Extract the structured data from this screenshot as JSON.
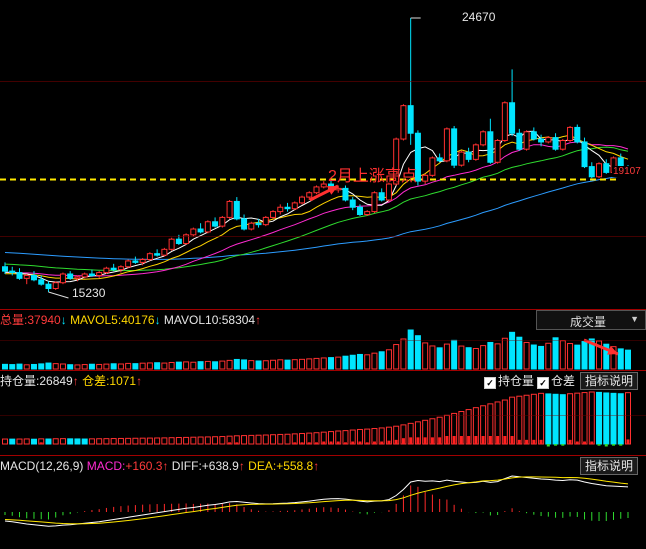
{
  "colors": {
    "up": "#ff3030",
    "down": "#00e5ff",
    "ma5": "#ffffff",
    "ma10": "#ffd400",
    "ma20": "#ff2bd1",
    "ma30": "#2fdc2f",
    "ma60": "#2c9cff",
    "dashed_line": "#ffea00",
    "macd_diff": "#ffffff",
    "macd_dea": "#ffe600"
  },
  "price_panel": {
    "high_label": "24670",
    "low_label": "15230",
    "last_price_label": "19107",
    "annotation": "2月上涨高点"
  },
  "volume_panel": {
    "total_label": "总量:",
    "total_value": "37940",
    "total_arrow": "↓",
    "mavol5_label": "MAVOL5:",
    "mavol5_value": "40176",
    "mavol5_arrow": "↓",
    "mavol10_label": "MAVOL10:",
    "mavol10_value": "58304",
    "mavol10_arrow": "↑",
    "dropdown_value": "成交量",
    "dropdown_icon": "triangle-down-icon"
  },
  "oi_panel": {
    "oi_label": "持仓量:",
    "oi_value": "26849",
    "oi_arrow": "↑",
    "diff_label": "仓差:",
    "diff_value": "1071",
    "diff_arrow": "↑",
    "check_oi": "持仓量",
    "check_diff": "仓差",
    "indicator_button": "指标说明"
  },
  "macd_panel": {
    "name_label": "MACD(12,26,9)",
    "macd_label": "MACD:",
    "macd_value": "+160.3",
    "macd_arrow": "↑",
    "diff_label": "DIFF:",
    "diff_value": "+638.9",
    "diff_arrow": "↑",
    "dea_label": "DEA:",
    "dea_value": "+558.8",
    "dea_arrow": "↑",
    "indicator_button": "指标说明"
  },
  "chart_data": {
    "type": "candlestick",
    "dashed_level": 19107,
    "ohlc": [
      [
        16100,
        16250,
        15850,
        15950
      ],
      [
        15950,
        16100,
        15800,
        15900
      ],
      [
        15900,
        16050,
        15650,
        15700
      ],
      [
        15700,
        15850,
        15500,
        15800
      ],
      [
        15800,
        15950,
        15600,
        15650
      ],
      [
        15650,
        15800,
        15450,
        15500
      ],
      [
        15500,
        15600,
        15230,
        15350
      ],
      [
        15350,
        15600,
        15300,
        15550
      ],
      [
        15550,
        15900,
        15500,
        15850
      ],
      [
        15850,
        15950,
        15650,
        15700
      ],
      [
        15700,
        15800,
        15600,
        15750
      ],
      [
        15750,
        15900,
        15700,
        15850
      ],
      [
        15850,
        16000,
        15750,
        15800
      ],
      [
        15800,
        15950,
        15700,
        15900
      ],
      [
        15900,
        16100,
        15850,
        16050
      ],
      [
        16050,
        16200,
        15950,
        16000
      ],
      [
        16000,
        16150,
        15900,
        16100
      ],
      [
        16100,
        16350,
        16050,
        16300
      ],
      [
        16300,
        16450,
        16200,
        16250
      ],
      [
        16250,
        16400,
        16150,
        16350
      ],
      [
        16350,
        16600,
        16300,
        16550
      ],
      [
        16550,
        16700,
        16450,
        16500
      ],
      [
        16500,
        16750,
        16450,
        16700
      ],
      [
        16700,
        17100,
        16650,
        17050
      ],
      [
        17050,
        17200,
        16850,
        16900
      ],
      [
        16900,
        17250,
        16850,
        17200
      ],
      [
        17200,
        17450,
        17150,
        17400
      ],
      [
        17400,
        17600,
        17250,
        17300
      ],
      [
        17300,
        17700,
        17250,
        17650
      ],
      [
        17650,
        17800,
        17450,
        17500
      ],
      [
        17500,
        17850,
        17450,
        17800
      ],
      [
        17800,
        18400,
        17750,
        18350
      ],
      [
        18350,
        18500,
        17700,
        17750
      ],
      [
        17750,
        17900,
        17350,
        17400
      ],
      [
        17400,
        17650,
        17350,
        17600
      ],
      [
        17600,
        17750,
        17450,
        17550
      ],
      [
        17550,
        17850,
        17500,
        17800
      ],
      [
        17800,
        18050,
        17750,
        18000
      ],
      [
        18000,
        18250,
        17900,
        18150
      ],
      [
        18150,
        18300,
        18000,
        18100
      ],
      [
        18100,
        18350,
        18050,
        18300
      ],
      [
        18300,
        18550,
        18250,
        18500
      ],
      [
        18500,
        18700,
        18400,
        18650
      ],
      [
        18650,
        18900,
        18600,
        18850
      ],
      [
        18850,
        19050,
        18800,
        18950
      ],
      [
        18950,
        19100,
        18700,
        18750
      ],
      [
        18750,
        18900,
        18650,
        18800
      ],
      [
        18800,
        18900,
        18350,
        18400
      ],
      [
        18400,
        18500,
        18050,
        18150
      ],
      [
        18150,
        18250,
        17850,
        17900
      ],
      [
        17900,
        18050,
        17850,
        18000
      ],
      [
        18000,
        18700,
        17950,
        18650
      ],
      [
        18650,
        18800,
        18350,
        18400
      ],
      [
        18400,
        19000,
        18350,
        18950
      ],
      [
        18950,
        20550,
        18900,
        20500
      ],
      [
        20500,
        21700,
        20450,
        21650
      ],
      [
        21650,
        24670,
        20300,
        20700
      ],
      [
        20700,
        20800,
        18900,
        19050
      ],
      [
        19050,
        19300,
        18950,
        19250
      ],
      [
        19250,
        19900,
        19200,
        19850
      ],
      [
        19850,
        20000,
        19700,
        19750
      ],
      [
        19750,
        20900,
        19700,
        20850
      ],
      [
        20850,
        20950,
        19500,
        19600
      ],
      [
        19600,
        20100,
        19550,
        20050
      ],
      [
        20050,
        20200,
        19700,
        19800
      ],
      [
        19800,
        20350,
        19750,
        20300
      ],
      [
        20300,
        20800,
        20250,
        20750
      ],
      [
        20750,
        21200,
        19650,
        19700
      ],
      [
        19700,
        20500,
        19650,
        20450
      ],
      [
        20450,
        21800,
        20400,
        21750
      ],
      [
        21750,
        22900,
        20600,
        20700
      ],
      [
        20700,
        20850,
        20100,
        20150
      ],
      [
        20150,
        20800,
        20100,
        20750
      ],
      [
        20750,
        20900,
        20450,
        20500
      ],
      [
        20500,
        20650,
        20250,
        20400
      ],
      [
        20400,
        20600,
        20350,
        20550
      ],
      [
        20550,
        20700,
        20100,
        20150
      ],
      [
        20150,
        20500,
        20100,
        20450
      ],
      [
        20450,
        20950,
        20400,
        20900
      ],
      [
        20900,
        21000,
        20350,
        20400
      ],
      [
        20400,
        20550,
        19500,
        19550
      ],
      [
        19550,
        19700,
        19150,
        19200
      ],
      [
        19200,
        19700,
        19150,
        19650
      ],
      [
        19650,
        19800,
        19300,
        19350
      ],
      [
        19350,
        19900,
        19300,
        19850
      ],
      [
        19850,
        20000,
        19400,
        19450
      ],
      [
        19450,
        19600,
        19200,
        19250
      ]
    ],
    "volume": [
      4000,
      3800,
      4200,
      3600,
      3900,
      4400,
      5100,
      4600,
      4300,
      3700,
      3500,
      3800,
      4100,
      3900,
      4200,
      4500,
      4300,
      4800,
      4600,
      5000,
      5200,
      5400,
      5100,
      5600,
      5900,
      6100,
      5800,
      6300,
      6500,
      6200,
      6800,
      7400,
      8200,
      7800,
      7200,
      6900,
      7100,
      7500,
      7900,
      7600,
      8000,
      8300,
      8700,
      9100,
      9500,
      9800,
      10200,
      11000,
      11800,
      12500,
      12200,
      13600,
      14800,
      16500,
      21000,
      25800,
      33500,
      28600,
      22400,
      19800,
      18200,
      21400,
      24600,
      19700,
      18300,
      17600,
      20100,
      22800,
      21600,
      26400,
      31500,
      27300,
      22800,
      20600,
      19400,
      22100,
      26800,
      24300,
      21900,
      20500,
      23600,
      25800,
      24100,
      21300,
      19200,
      17300,
      16200
    ],
    "open_interest": [
      2600,
      2550,
      2600,
      2650,
      2500,
      2700,
      2600,
      2750,
      2800,
      2700,
      2650,
      2600,
      2700,
      2750,
      2800,
      2850,
      2900,
      2950,
      3000,
      3050,
      3100,
      3150,
      3200,
      3300,
      3400,
      3450,
      3550,
      3650,
      3700,
      3800,
      3900,
      4100,
      4300,
      4400,
      4500,
      4600,
      4700,
      4850,
      5000,
      5100,
      5300,
      5500,
      5700,
      5900,
      6200,
      6500,
      6800,
      7000,
      7300,
      7600,
      7800,
      8100,
      8400,
      8800,
      9300,
      10000,
      10800,
      11600,
      12400,
      13200,
      14000,
      15000,
      16000,
      17000,
      18000,
      19000,
      20000,
      21000,
      22000,
      23000,
      24500,
      25000,
      25500,
      26000,
      26500,
      26200,
      26000,
      25800,
      26300,
      26600,
      26900,
      27200,
      27000,
      26700,
      26500,
      26300,
      26849
    ],
    "macd": {
      "diff": [
        -120,
        -130,
        -145,
        -160,
        -170,
        -180,
        -190,
        -185,
        -175,
        -170,
        -160,
        -150,
        -140,
        -130,
        -115,
        -100,
        -85,
        -70,
        -55,
        -40,
        -25,
        -10,
        5,
        20,
        35,
        50,
        60,
        75,
        90,
        100,
        115,
        135,
        140,
        130,
        120,
        112,
        108,
        110,
        115,
        118,
        125,
        135,
        145,
        158,
        170,
        176,
        178,
        172,
        160,
        145,
        135,
        145,
        148,
        165,
        220,
        300,
        400,
        420,
        410,
        415,
        405,
        425,
        410,
        400,
        390,
        395,
        410,
        395,
        405,
        445,
        480,
        470,
        460,
        450,
        440,
        435,
        425,
        420,
        430,
        425,
        400,
        380,
        365,
        350,
        345,
        340,
        335
      ],
      "dea": [
        -100,
        -105,
        -110,
        -118,
        -125,
        -132,
        -140,
        -148,
        -153,
        -156,
        -157,
        -156,
        -153,
        -149,
        -142,
        -134,
        -124,
        -113,
        -101,
        -89,
        -76,
        -63,
        -49,
        -35,
        -21,
        -7,
        6,
        20,
        34,
        47,
        61,
        76,
        89,
        97,
        102,
        104,
        105,
        106,
        108,
        110,
        113,
        118,
        123,
        130,
        138,
        146,
        152,
        156,
        157,
        155,
        151,
        150,
        149,
        152,
        166,
        189,
        223,
        252,
        276,
        299,
        318,
        342,
        362,
        378,
        391,
        402,
        414,
        418,
        425,
        439,
        455,
        465,
        468,
        468,
        467,
        466,
        463,
        459,
        460,
        458,
        450,
        438,
        425,
        410,
        398,
        385,
        375
      ]
    }
  }
}
